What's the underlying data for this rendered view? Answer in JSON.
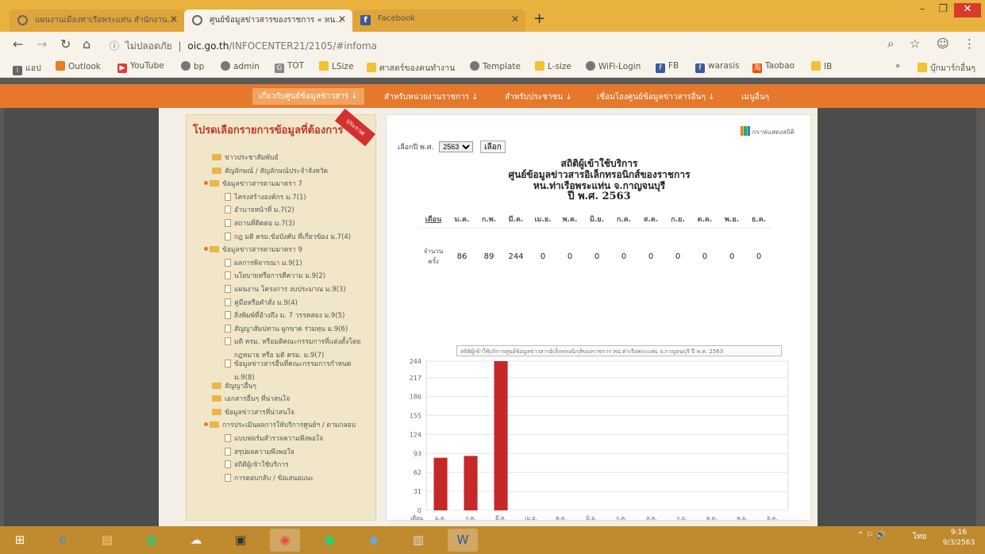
{
  "browser": {
    "tabs": [
      {
        "label": "แผนงานเมืองท่าเรือพระแท่น สำนักงาน...",
        "icon": "globe-icon"
      },
      {
        "label": "ศูนย์ข้อมูลข่าวสารของราชการ « หน...",
        "icon": "globe-icon"
      },
      {
        "label": "Facebook",
        "icon": "facebook-icon"
      }
    ],
    "new_tab": "+",
    "url_security": "ไม่ปลอดภัย",
    "url_host": "oic.go.th",
    "url_path": "/INFOCENTER21/2105/#infoma",
    "bookmarks": [
      "แอป",
      "Outlook",
      "YouTube",
      "bp",
      "admin",
      "TOT",
      "LSize",
      "ศาสตร์ของคนทำงาน",
      "Template",
      "L-size",
      "WiFi-Login",
      "FB",
      "warasis",
      "Taobao",
      "IB"
    ],
    "other_bookmarks": "บุ๊กมาร์กอื่นๆ"
  },
  "site_menu": [
    "เกี่ยวกับศูนย์ข้อมูลข่าวสาร",
    "สำหรับหน่วยงานราชการ",
    "สำหรับประชาชน",
    "เชื่อมโยงศูนย์ข้อมูลข่าวสารอื่นๆ",
    "เมนูอื่นๆ"
  ],
  "left_menu": {
    "title": "โปรดเลือกรายการข้อมูลที่ต้องการ",
    "ribbon": "ประกาศ",
    "items": [
      {
        "label": "ข่าวประชาสัมพันธ์",
        "kind": "folder",
        "indent": 0
      },
      {
        "label": "สัญลักษณ์ / สัญลักษณ์ประจำจังหวัด",
        "kind": "folder",
        "indent": 0
      },
      {
        "label": "ข้อมูลข่าวสารตามมาตรา 7",
        "kind": "folder-open",
        "indent": 0
      },
      {
        "label": "โครงสร้างองค์กร ม.7(1)",
        "kind": "doc",
        "indent": 1
      },
      {
        "label": "อำนาจหน้าที่ ม.7(2)",
        "kind": "doc",
        "indent": 1
      },
      {
        "label": "สถานที่ติดต่อ ม.7(3)",
        "kind": "doc",
        "indent": 1
      },
      {
        "label": "กฎ มติ ครม.ข้อบังคับ ที่เกี่ยวข้อง ม.7(4)",
        "kind": "doc",
        "indent": 1
      },
      {
        "label": "ข้อมูลข่าวสารตามมาตรา 9",
        "kind": "folder-open",
        "indent": 0
      },
      {
        "label": "ผลการพิจารณา ม.9(1)",
        "kind": "doc",
        "indent": 1
      },
      {
        "label": "นโยบายหรือการตีความ ม.9(2)",
        "kind": "doc",
        "indent": 1
      },
      {
        "label": "แผนงาน โครงการ งบประมาณ ม.9(3)",
        "kind": "doc",
        "indent": 1
      },
      {
        "label": "คู่มือหรือคำสั่ง ม.9(4)",
        "kind": "doc",
        "indent": 1
      },
      {
        "label": "สิ่งพิมพ์ที่อ้างถึง ม. 7 วรรคสอง ม.9(5)",
        "kind": "doc",
        "indent": 1
      },
      {
        "label": "สัญญาสัมปทาน ผูกขาด ร่วมทุน ม.9(6)",
        "kind": "doc",
        "indent": 1
      },
      {
        "label": "มติ ครม. หรือมติคณะกรรมการที่แต่งตั้งโดย",
        "kind": "doc",
        "indent": 1
      },
      {
        "label": "กฎหมาย หรือ มติ ครม. ม.9(7)",
        "kind": "none",
        "indent": 1
      },
      {
        "label": "ข้อมูลข่าวสารอื่นที่คณะกรรมการกำหนด",
        "kind": "doc",
        "indent": 1
      },
      {
        "label": "ม.9(8)",
        "kind": "none",
        "indent": 1
      },
      {
        "label": "สัญญาอื่นๆ",
        "kind": "folder",
        "indent": 0
      },
      {
        "label": "เอกสารอื่นๆ ที่น่าสนใจ",
        "kind": "folder",
        "indent": 0
      },
      {
        "label": "ข้อมูลข่าวสารที่น่าสนใจ",
        "kind": "folder",
        "indent": 0
      },
      {
        "label": "การประเมินผลการให้บริการศูนย์ฯ / ตามกลอบ",
        "kind": "folder-open",
        "indent": 0
      },
      {
        "label": "แบบฟอร์มสำรวจความพึงพอใจ",
        "kind": "doc",
        "indent": 1
      },
      {
        "label": "สรุปผลความพึงพอใจ",
        "kind": "doc",
        "indent": 1
      },
      {
        "label": "สถิติผู้เข้าใช้บริการ",
        "kind": "doc",
        "indent": 1
      },
      {
        "label": "การตอบกลับ / ข้อเสนอแนะ",
        "kind": "doc",
        "indent": 1
      }
    ]
  },
  "panel": {
    "year_label": "เลือกปี พ.ศ.",
    "year_value": "2563",
    "select_button": "เลือก",
    "chart_link": "กราฟแสดงสถิติ",
    "title1": "สถิติผู้เข้าใช้บริการ",
    "title2": "ศูนย์ข้อมูลข่าวสารอิเล็กทรอนิกส์ของราชการ",
    "title3": "หน.ท่าเรือพระแท่น จ.กาญจนบุรี",
    "title4": "ปี พ.ศ. 2563",
    "table_first_header": "เดือน",
    "table_row_label": "จำนวนครั้ง",
    "chart_caption": "สถิติผู้เข้าใช้บริการศูนย์ข้อมูลข่าวสารอิเล็กทรอนิกส์ของราชการ หน.ท่าเรือพระแท่น จ.กาญจนบุรี ปี พ.ศ. 2563"
  },
  "chart_data": {
    "type": "bar",
    "title": "สถิติผู้เข้าใช้บริการศูนย์ข้อมูลข่าวสารอิเล็กทรอนิกส์ของราชการ หน.ท่าเรือพระแท่น จ.กาญจนบุรี ปี พ.ศ. 2563",
    "categories": [
      "ม.ค.",
      "ก.พ.",
      "มี.ค.",
      "เม.ย.",
      "พ.ค.",
      "มิ.ย.",
      "ก.ค.",
      "ส.ค.",
      "ก.ย.",
      "ต.ค.",
      "พ.ย.",
      "ธ.ค."
    ],
    "values": [
      86,
      89,
      244,
      0,
      0,
      0,
      0,
      0,
      0,
      0,
      0,
      0
    ],
    "xlabel": "เดือน",
    "ylabel": "",
    "yticks": [
      0,
      31,
      62,
      93,
      124,
      155,
      186,
      217,
      244
    ],
    "ylim": [
      0,
      244
    ],
    "bar_color": "#c62828",
    "grid": true
  },
  "taskbar": {
    "apps": [
      "windows-start",
      "internet-explorer",
      "file-explorer",
      "store",
      "cloud",
      "snip",
      "chrome",
      "line",
      "notes",
      "calculator",
      "word"
    ],
    "language": "ไทย",
    "time": "9:16",
    "date": "9/3/2563"
  },
  "colors": {
    "accent_orange": "#e5782b",
    "tabstrip": "#e9b23e",
    "taskbar": "#c08a2f",
    "bar_red": "#c62828"
  }
}
